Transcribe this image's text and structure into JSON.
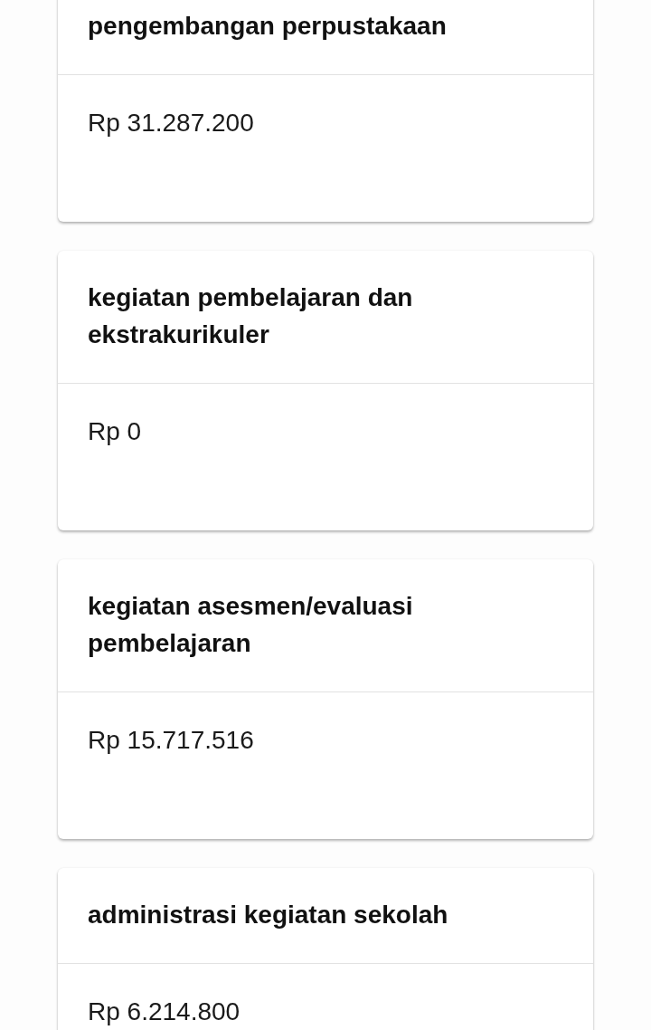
{
  "cards": [
    {
      "title": "pengembangan perpustakaan",
      "amount": "Rp 31.287.200"
    },
    {
      "title": "kegiatan pembelajaran dan ekstrakurikuler",
      "amount": "Rp 0"
    },
    {
      "title": "kegiatan asesmen/evaluasi pembelajaran",
      "amount": "Rp 15.717.516"
    },
    {
      "title": "administrasi kegiatan sekolah",
      "amount": "Rp 6.214.800"
    }
  ]
}
